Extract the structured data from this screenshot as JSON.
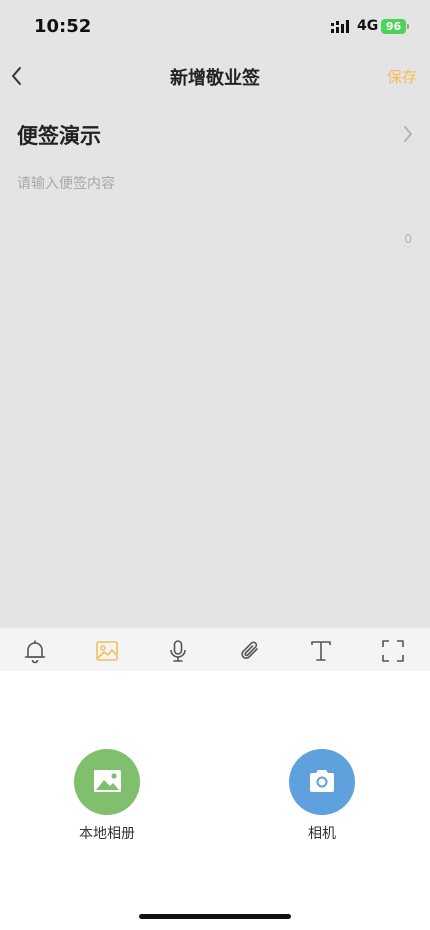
{
  "status_bar": {
    "time": "10:52",
    "network": "4G",
    "battery": "96"
  },
  "nav": {
    "title": "新增敬业签",
    "save_label": "保存"
  },
  "note": {
    "title": "便签演示",
    "placeholder": "请输入便签内容",
    "char_count": "0"
  },
  "toolbar": {
    "items": [
      {
        "icon": "bell-icon"
      },
      {
        "icon": "image-icon",
        "active": true
      },
      {
        "icon": "microphone-icon"
      },
      {
        "icon": "paperclip-icon"
      },
      {
        "icon": "text-format-icon"
      },
      {
        "icon": "fullscreen-icon"
      }
    ]
  },
  "picker": {
    "album_label": "本地相册",
    "camera_label": "相机"
  },
  "colors": {
    "accent": "#f3bd5d",
    "album": "#7fbf6d",
    "camera": "#5fa1dd",
    "background": "#e4e4e4"
  }
}
